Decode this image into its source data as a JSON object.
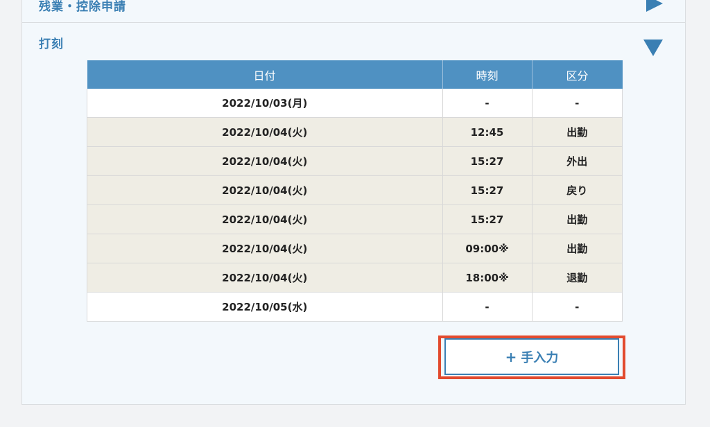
{
  "sections": {
    "overtime": {
      "title": "残業・控除申請"
    },
    "punch": {
      "title": "打刻"
    }
  },
  "table": {
    "headers": [
      "日付",
      "時刻",
      "区分"
    ],
    "rows": [
      {
        "date": "2022/10/03(月)",
        "time": "-",
        "type": "-",
        "bg": "white"
      },
      {
        "date": "2022/10/04(火)",
        "time": "12:45",
        "type": "出勤",
        "bg": "beige"
      },
      {
        "date": "2022/10/04(火)",
        "time": "15:27",
        "type": "外出",
        "bg": "beige"
      },
      {
        "date": "2022/10/04(火)",
        "time": "15:27",
        "type": "戻り",
        "bg": "beige"
      },
      {
        "date": "2022/10/04(火)",
        "time": "15:27",
        "type": "出勤",
        "bg": "beige"
      },
      {
        "date": "2022/10/04(火)",
        "time": "09:00※",
        "type": "出勤",
        "bg": "beige"
      },
      {
        "date": "2022/10/04(火)",
        "time": "18:00※",
        "type": "退勤",
        "bg": "beige"
      },
      {
        "date": "2022/10/05(水)",
        "time": "-",
        "type": "-",
        "bg": "white"
      }
    ]
  },
  "manual_entry": {
    "icon": "plus-icon",
    "label": "手入力"
  },
  "colors": {
    "accent": "#3a7fb3",
    "header_bg": "#4f91c2",
    "highlight": "#e24a2e",
    "row_beige": "#efede4"
  }
}
